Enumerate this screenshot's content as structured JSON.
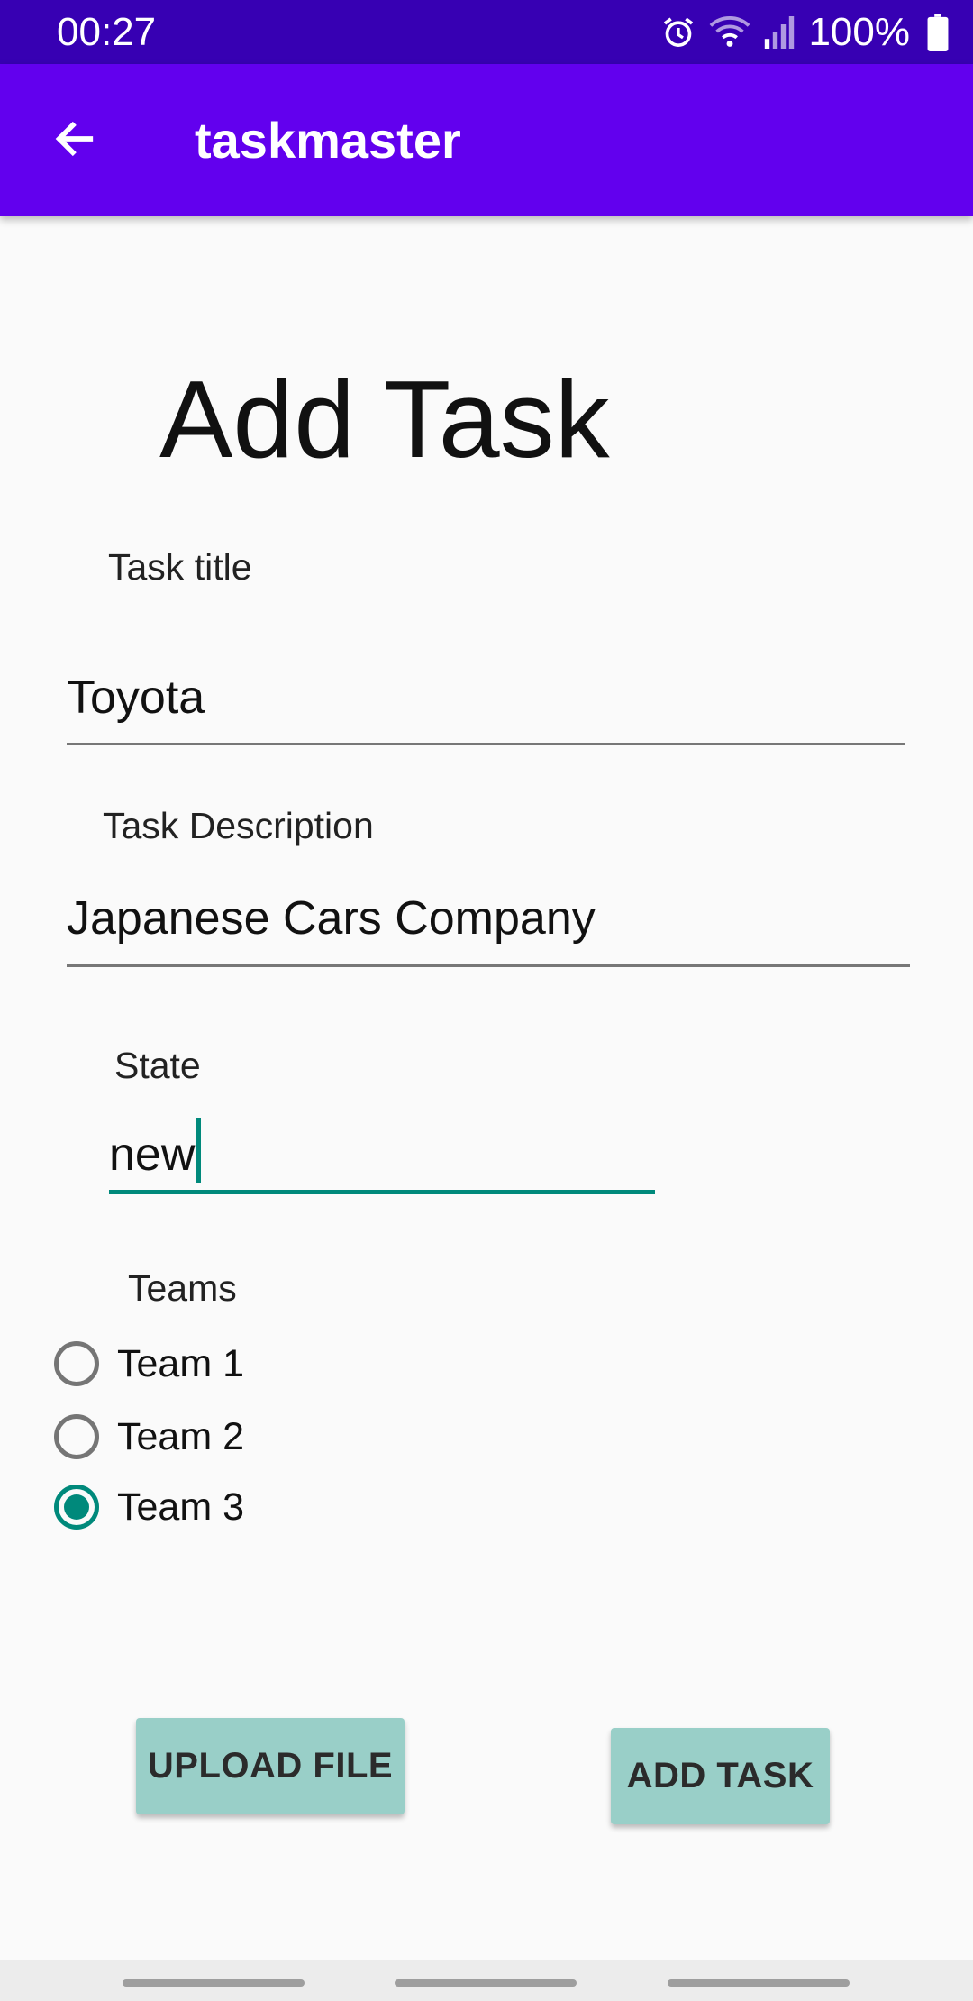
{
  "status": {
    "time": "00:27",
    "battery": "100%"
  },
  "appbar": {
    "title": "taskmaster"
  },
  "page": {
    "heading": "Add Task"
  },
  "form": {
    "title_label": "Task title",
    "title_value": "Toyota",
    "description_label": "Task Description",
    "description_value": "Japanese Cars Company",
    "state_label": "State",
    "state_value": "new",
    "teams_label": "Teams",
    "teams": [
      {
        "label": "Team 1",
        "checked": false
      },
      {
        "label": "Team 2",
        "checked": false
      },
      {
        "label": "Team 3",
        "checked": true
      }
    ]
  },
  "buttons": {
    "upload": "UPLOAD FILE",
    "add": "ADD TASK"
  },
  "colors": {
    "statusbar": "#3700b3",
    "appbar": "#6200ee",
    "accent": "#00897b",
    "button": "#99cfc8"
  },
  "icons": [
    "back-arrow-icon",
    "alarm-icon",
    "wifi-icon",
    "signal-icon",
    "battery-icon"
  ]
}
